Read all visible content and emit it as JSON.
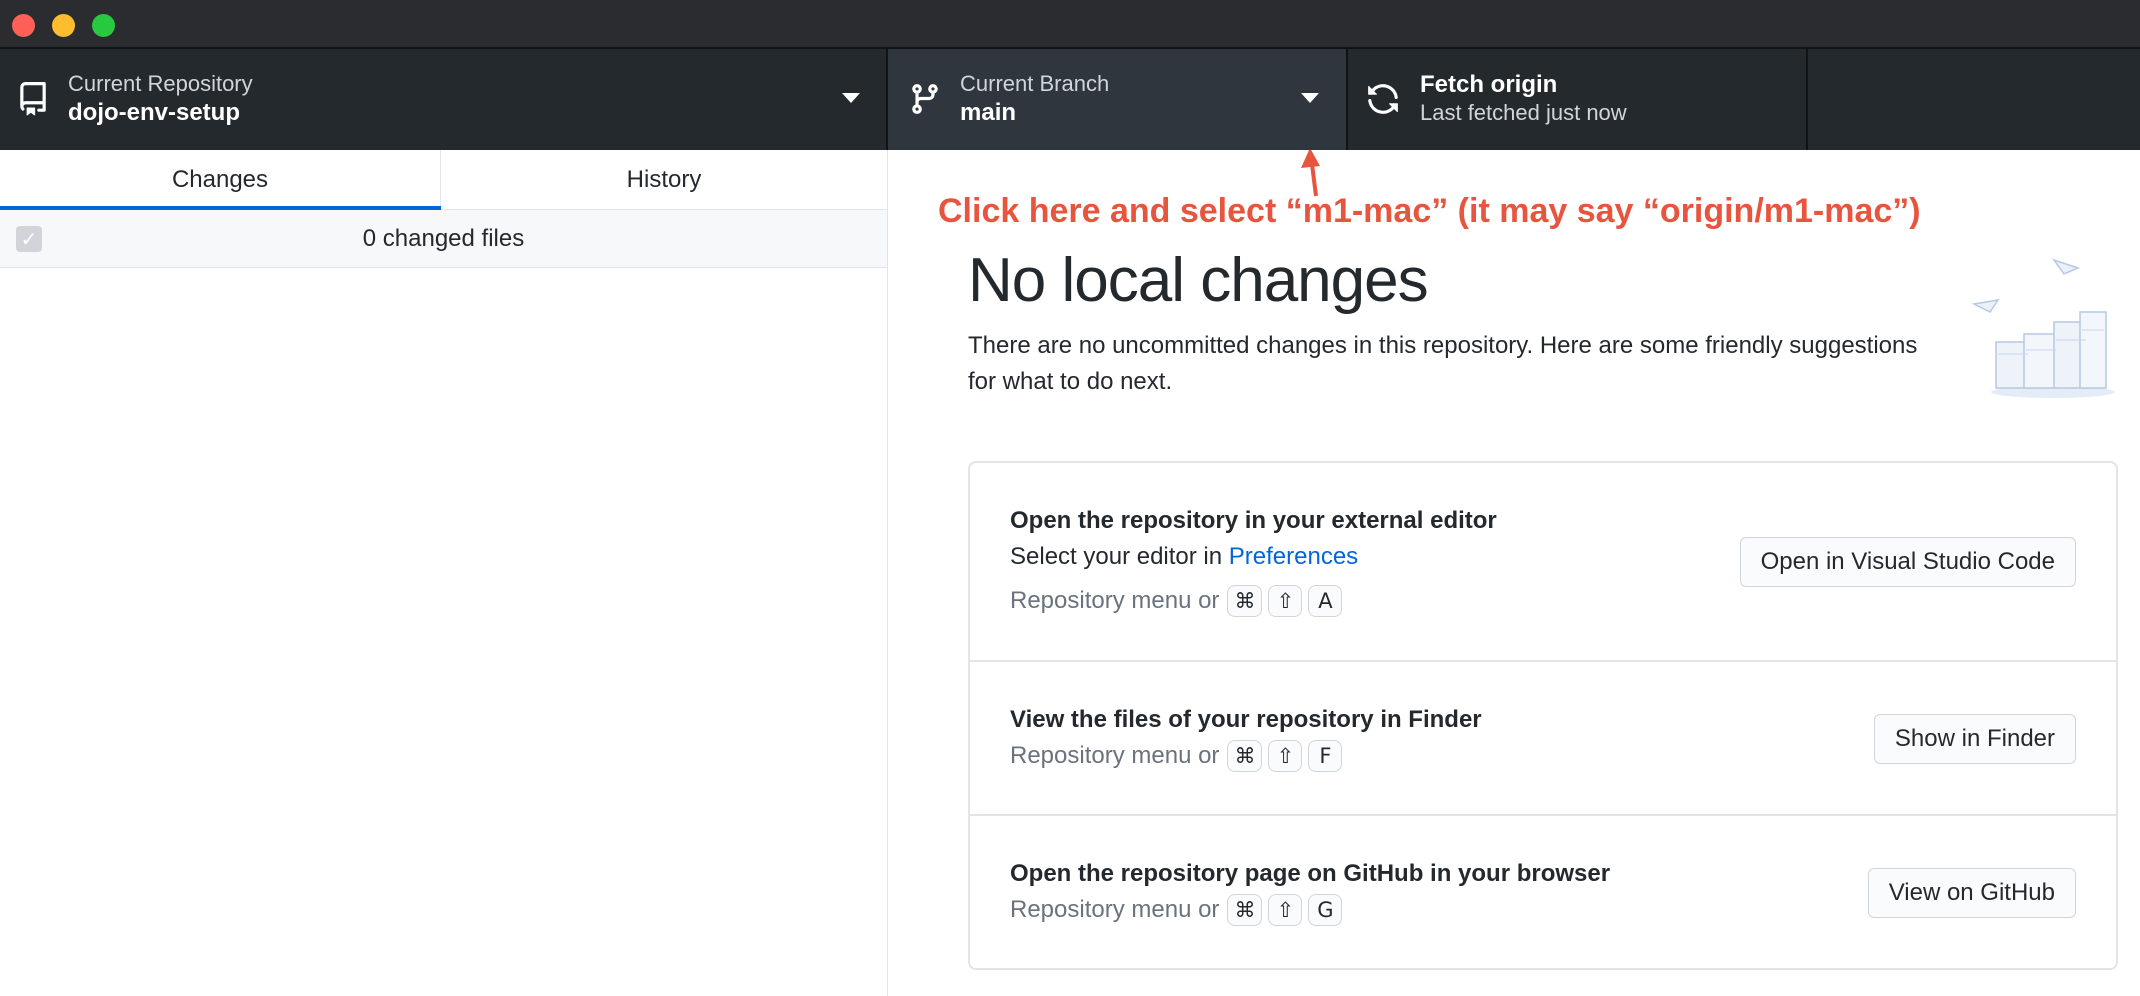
{
  "toolbar": {
    "repository": {
      "caption": "Current Repository",
      "value": "dojo-env-setup"
    },
    "branch": {
      "caption": "Current Branch",
      "value": "main"
    },
    "fetch": {
      "title": "Fetch origin",
      "subtitle": "Last fetched just now"
    }
  },
  "sidebar": {
    "tabs": [
      {
        "label": "Changes",
        "selected": true
      },
      {
        "label": "History",
        "selected": false
      }
    ],
    "changed_files": "0 changed files"
  },
  "main": {
    "annotation": "Click here and select “m1-mac” (it may say “origin/m1-mac”)",
    "heading": "No local changes",
    "intro": "There are no uncommitted changes in this repository. Here are some friendly suggestions for what to do next.",
    "shortcut_prefix": "Repository menu or",
    "cards": [
      {
        "title": "Open the repository in your external editor",
        "desc_prefix": "Select your editor in ",
        "desc_link": "Preferences",
        "keys": [
          "⌘",
          "⇧",
          "A"
        ],
        "button": "Open in Visual Studio Code"
      },
      {
        "title": "View the files of your repository in Finder",
        "keys": [
          "⌘",
          "⇧",
          "F"
        ],
        "button": "Show in Finder"
      },
      {
        "title": "Open the repository page on GitHub in your browser",
        "keys": [
          "⌘",
          "⇧",
          "G"
        ],
        "button": "View on GitHub"
      }
    ]
  },
  "colors": {
    "toolbar_bg": "#24292e",
    "accent": "#0366d6",
    "annotation": "#e8553e"
  }
}
